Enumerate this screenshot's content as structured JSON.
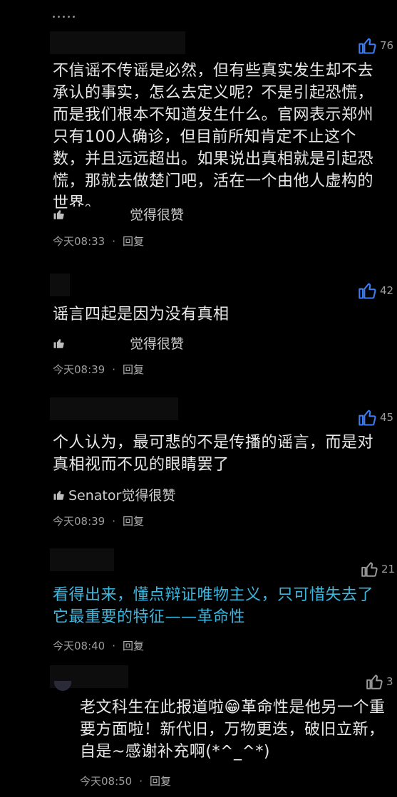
{
  "colors": {
    "background": "#000000",
    "text": "#e8e8e8",
    "accent_cyan": "#3fb6dd",
    "like_blue": "#3d7bf0",
    "like_gray": "#9a9a9a",
    "meta": "#9d9d9d"
  },
  "comments": [
    {
      "like_count": "76",
      "liked": true,
      "text": "不信谣不传谣是必然，但有些真实发生却不去承认的事实，怎么去定义呢？不是引起恐慌，而是我们根本不知道发生什么。官网表示郑州只有100人确诊，但目前所知肯定不止这个数，并且远远超出。如果说出真相就是引起恐慌，那就去做楚门吧，活在一个由他人虚构的世界。",
      "liked_by": "觉得很赞",
      "time": "今天08:33",
      "reply_label": "回复"
    },
    {
      "like_count": "42",
      "liked": true,
      "text": "谣言四起是因为没有真相",
      "liked_by": "觉得很赞",
      "time": "今天08:39",
      "reply_label": "回复"
    },
    {
      "like_count": "45",
      "liked": true,
      "text": "个人认为，最可悲的不是传播的谣言，而是对真相视而不见的眼睛罢了",
      "liked_by": "Senator觉得很赞",
      "time": "今天08:39",
      "reply_label": "回复"
    },
    {
      "like_count": "21",
      "liked": false,
      "text": "看得出来，懂点辩证唯物主义，只可惜失去了它最重要的特征——革命性",
      "time": "今天08:40",
      "reply_label": "回复"
    },
    {
      "like_count": "3",
      "liked": false,
      "text_before": "老文科生在此报道啦",
      "emoji": "😁",
      "text_after": "革命性是他另一个重要方面啦！新代旧，万物更迭，破旧立新，自是~感谢补充啊(*^_^*)",
      "time": "今天08:50",
      "reply_label": "回复"
    }
  ],
  "separator": "·"
}
